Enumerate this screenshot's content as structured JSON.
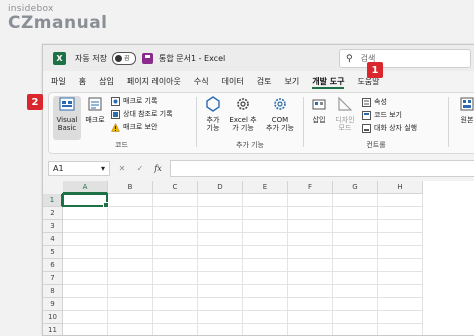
{
  "watermark": {
    "line1": "insidebox",
    "line2": "CZmanual"
  },
  "titlebar": {
    "app_icon": "X",
    "autosave_label": "자동 저장",
    "toggle_text": "끔",
    "document_title": "통합 문서1  -  Excel",
    "search_placeholder": "검색"
  },
  "tabs": [
    {
      "label": "파일"
    },
    {
      "label": "홈"
    },
    {
      "label": "삽입"
    },
    {
      "label": "페이지 레이아웃"
    },
    {
      "label": "수식"
    },
    {
      "label": "데이터"
    },
    {
      "label": "검토"
    },
    {
      "label": "보기"
    },
    {
      "label": "개발 도구",
      "active": true
    },
    {
      "label": "도움말"
    }
  ],
  "ribbon": {
    "code": {
      "visual_basic": [
        "Visual",
        "Basic"
      ],
      "macro": "매크로",
      "record_macro": "매크로 기록",
      "relative_ref": "상대 참조로 기록",
      "macro_security": "매크로 보안",
      "group_label": "코드"
    },
    "addins": {
      "addins_btn": [
        "추가",
        "기능"
      ],
      "excel_addins": [
        "Excel 추",
        "가 기능"
      ],
      "com_addins": [
        "COM",
        "추가 기능"
      ],
      "group_label": "추가 기능"
    },
    "controls": {
      "insert": "삽입",
      "design_mode": [
        "디자인",
        "모드"
      ],
      "properties": "속성",
      "view_code": "코드 보기",
      "run_dialog": "대화 상자 실행",
      "group_label": "컨트롤"
    },
    "source": {
      "label": "원본"
    }
  },
  "badges": {
    "one": "1",
    "two": "2"
  },
  "formula_bar": {
    "name_box": "A1",
    "name_box_arrow": "▾",
    "cancel": "✕",
    "enter": "✓",
    "fx": "fx"
  },
  "grid": {
    "columns": [
      "A",
      "B",
      "C",
      "D",
      "E",
      "F",
      "G",
      "H"
    ],
    "rows": [
      "1",
      "2",
      "3",
      "4",
      "5",
      "6",
      "7",
      "8",
      "9",
      "10",
      "11"
    ],
    "selected_cell": "A1"
  },
  "colors": {
    "excel_green": "#1e7145",
    "badge_red": "#d9272d",
    "icon_blue": "#2b6cb0"
  }
}
